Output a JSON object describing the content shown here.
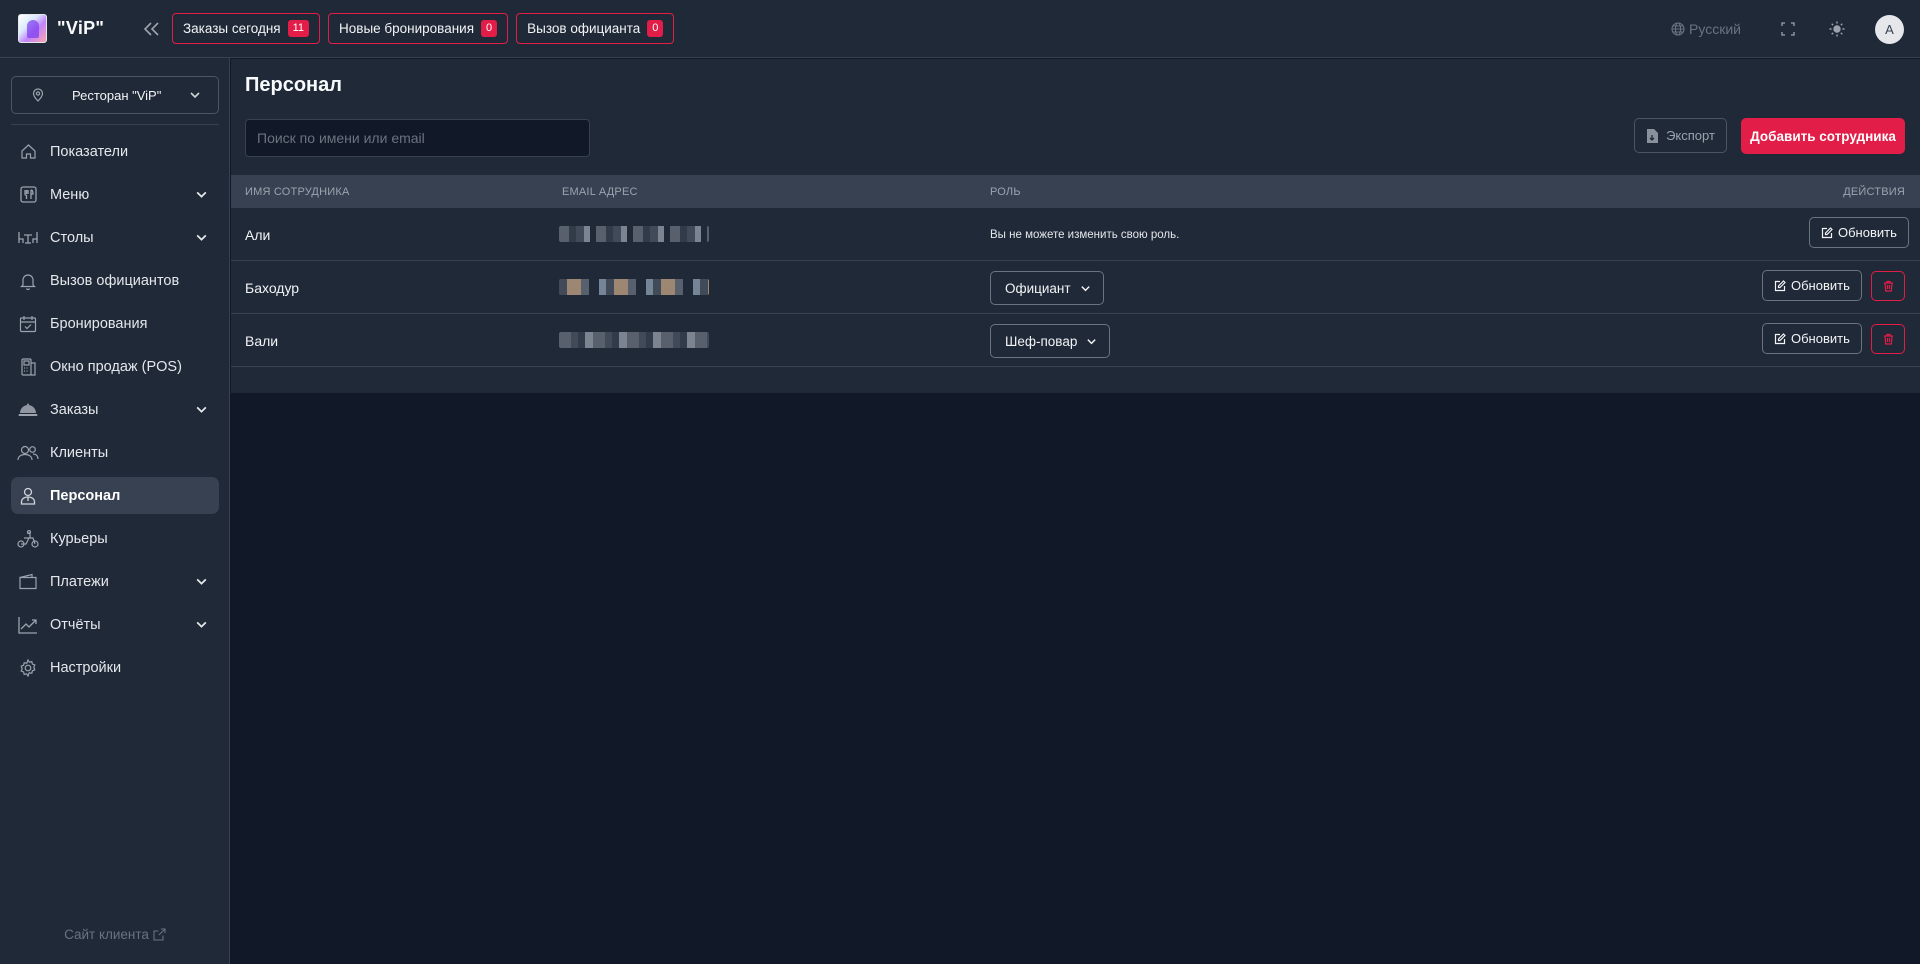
{
  "header": {
    "brand": "\"ViP\"",
    "badges": [
      {
        "label": "Заказы сегодня",
        "count": "11"
      },
      {
        "label": "Новые бронирования",
        "count": "0"
      },
      {
        "label": "Вызов официанта",
        "count": "0"
      }
    ],
    "language": "Русский",
    "avatar_initial": "A"
  },
  "sidebar": {
    "restaurant_select": "Ресторан \"ViP\"",
    "items": [
      {
        "label": "Показатели",
        "icon": "home-icon"
      },
      {
        "label": "Меню",
        "icon": "utensils-icon",
        "expandable": true
      },
      {
        "label": "Столы",
        "icon": "table-icon",
        "expandable": true
      },
      {
        "label": "Вызов официантов",
        "icon": "bell-icon"
      },
      {
        "label": "Бронирования",
        "icon": "calendar-check-icon"
      },
      {
        "label": "Окно продаж (POS)",
        "icon": "pos-terminal-icon"
      },
      {
        "label": "Заказы",
        "icon": "cloche-icon",
        "expandable": true
      },
      {
        "label": "Клиенты",
        "icon": "users-icon"
      },
      {
        "label": "Персонал",
        "icon": "staff-icon",
        "active": true
      },
      {
        "label": "Курьеры",
        "icon": "courier-icon"
      },
      {
        "label": "Платежи",
        "icon": "wallet-icon",
        "expandable": true
      },
      {
        "label": "Отчёты",
        "icon": "chart-line-icon",
        "expandable": true
      },
      {
        "label": "Настройки",
        "icon": "gear-icon"
      }
    ],
    "client_site": "Сайт клиента"
  },
  "main": {
    "title": "Персонал",
    "search_placeholder": "Поиск по имени или email",
    "export_label": "Экспорт",
    "add_label": "Добавить сотрудника",
    "columns": [
      "ИМЯ СОТРУДНИКА",
      "EMAIL АДРЕС",
      "РОЛЬ",
      "ДЕЙСТВИЯ"
    ],
    "rows": [
      {
        "name": "Али",
        "role_note": "Вы не можете изменить свою роль.",
        "role": "",
        "update_label": "Обновить",
        "deletable": false
      },
      {
        "name": "Баходур",
        "role_note": "",
        "role": "Официант",
        "update_label": "Обновить",
        "deletable": true
      },
      {
        "name": "Вали",
        "role_note": "",
        "role": "Шеф-повар",
        "update_label": "Обновить",
        "deletable": true
      }
    ]
  },
  "colors": {
    "accent": "#e11d48",
    "background": "#111827",
    "panel": "#1f2937"
  }
}
